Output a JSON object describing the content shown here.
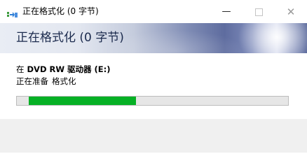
{
  "window": {
    "title": "正在格式化 (0 字节)",
    "icon": "format-drive-icon",
    "controls": {
      "minimize": "—",
      "close": "✕"
    }
  },
  "banner": {
    "title": "正在格式化 (0 字节)"
  },
  "drive": {
    "prefix": "在",
    "name": "DVD RW 驱动器 (E:)"
  },
  "status": {
    "stage": "正在准备",
    "action": "格式化"
  },
  "progress": {
    "start_fraction": 0.045,
    "fraction": 0.395,
    "fill_color": "#06b025"
  }
}
